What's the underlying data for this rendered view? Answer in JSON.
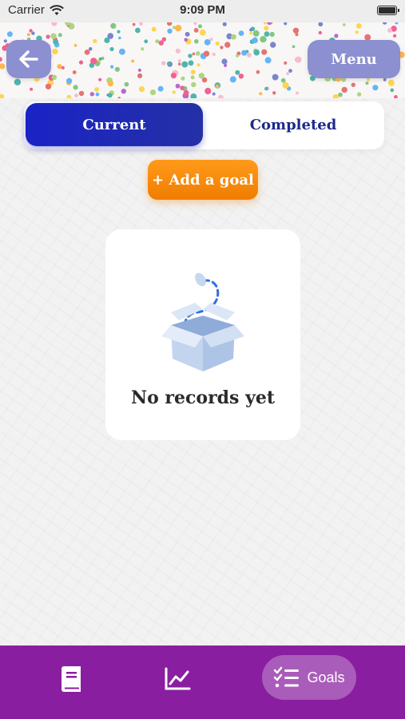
{
  "status_bar": {
    "carrier": "Carrier",
    "time": "9:09 PM",
    "battery_level": 1.0
  },
  "header": {
    "back_icon": "arrow-left-icon",
    "menu_label": "Menu"
  },
  "tabs": {
    "items": [
      {
        "label": "Current",
        "active": true
      },
      {
        "label": "Completed",
        "active": false
      }
    ]
  },
  "actions": {
    "add_goal_label": "+ Add a goal"
  },
  "empty_state": {
    "icon": "empty-box-icon",
    "message": "No records yet"
  },
  "bottom_nav": {
    "items": [
      {
        "icon": "book-icon",
        "label": ""
      },
      {
        "icon": "chart-icon",
        "label": ""
      },
      {
        "icon": "checklist-icon",
        "label": "Goals",
        "active": true
      }
    ]
  },
  "colors": {
    "primary_blue": "#1a23c4",
    "accent_orange": "#f58a00",
    "nav_purple": "#8a1ea0",
    "button_lavender": "#8c8fd0"
  }
}
